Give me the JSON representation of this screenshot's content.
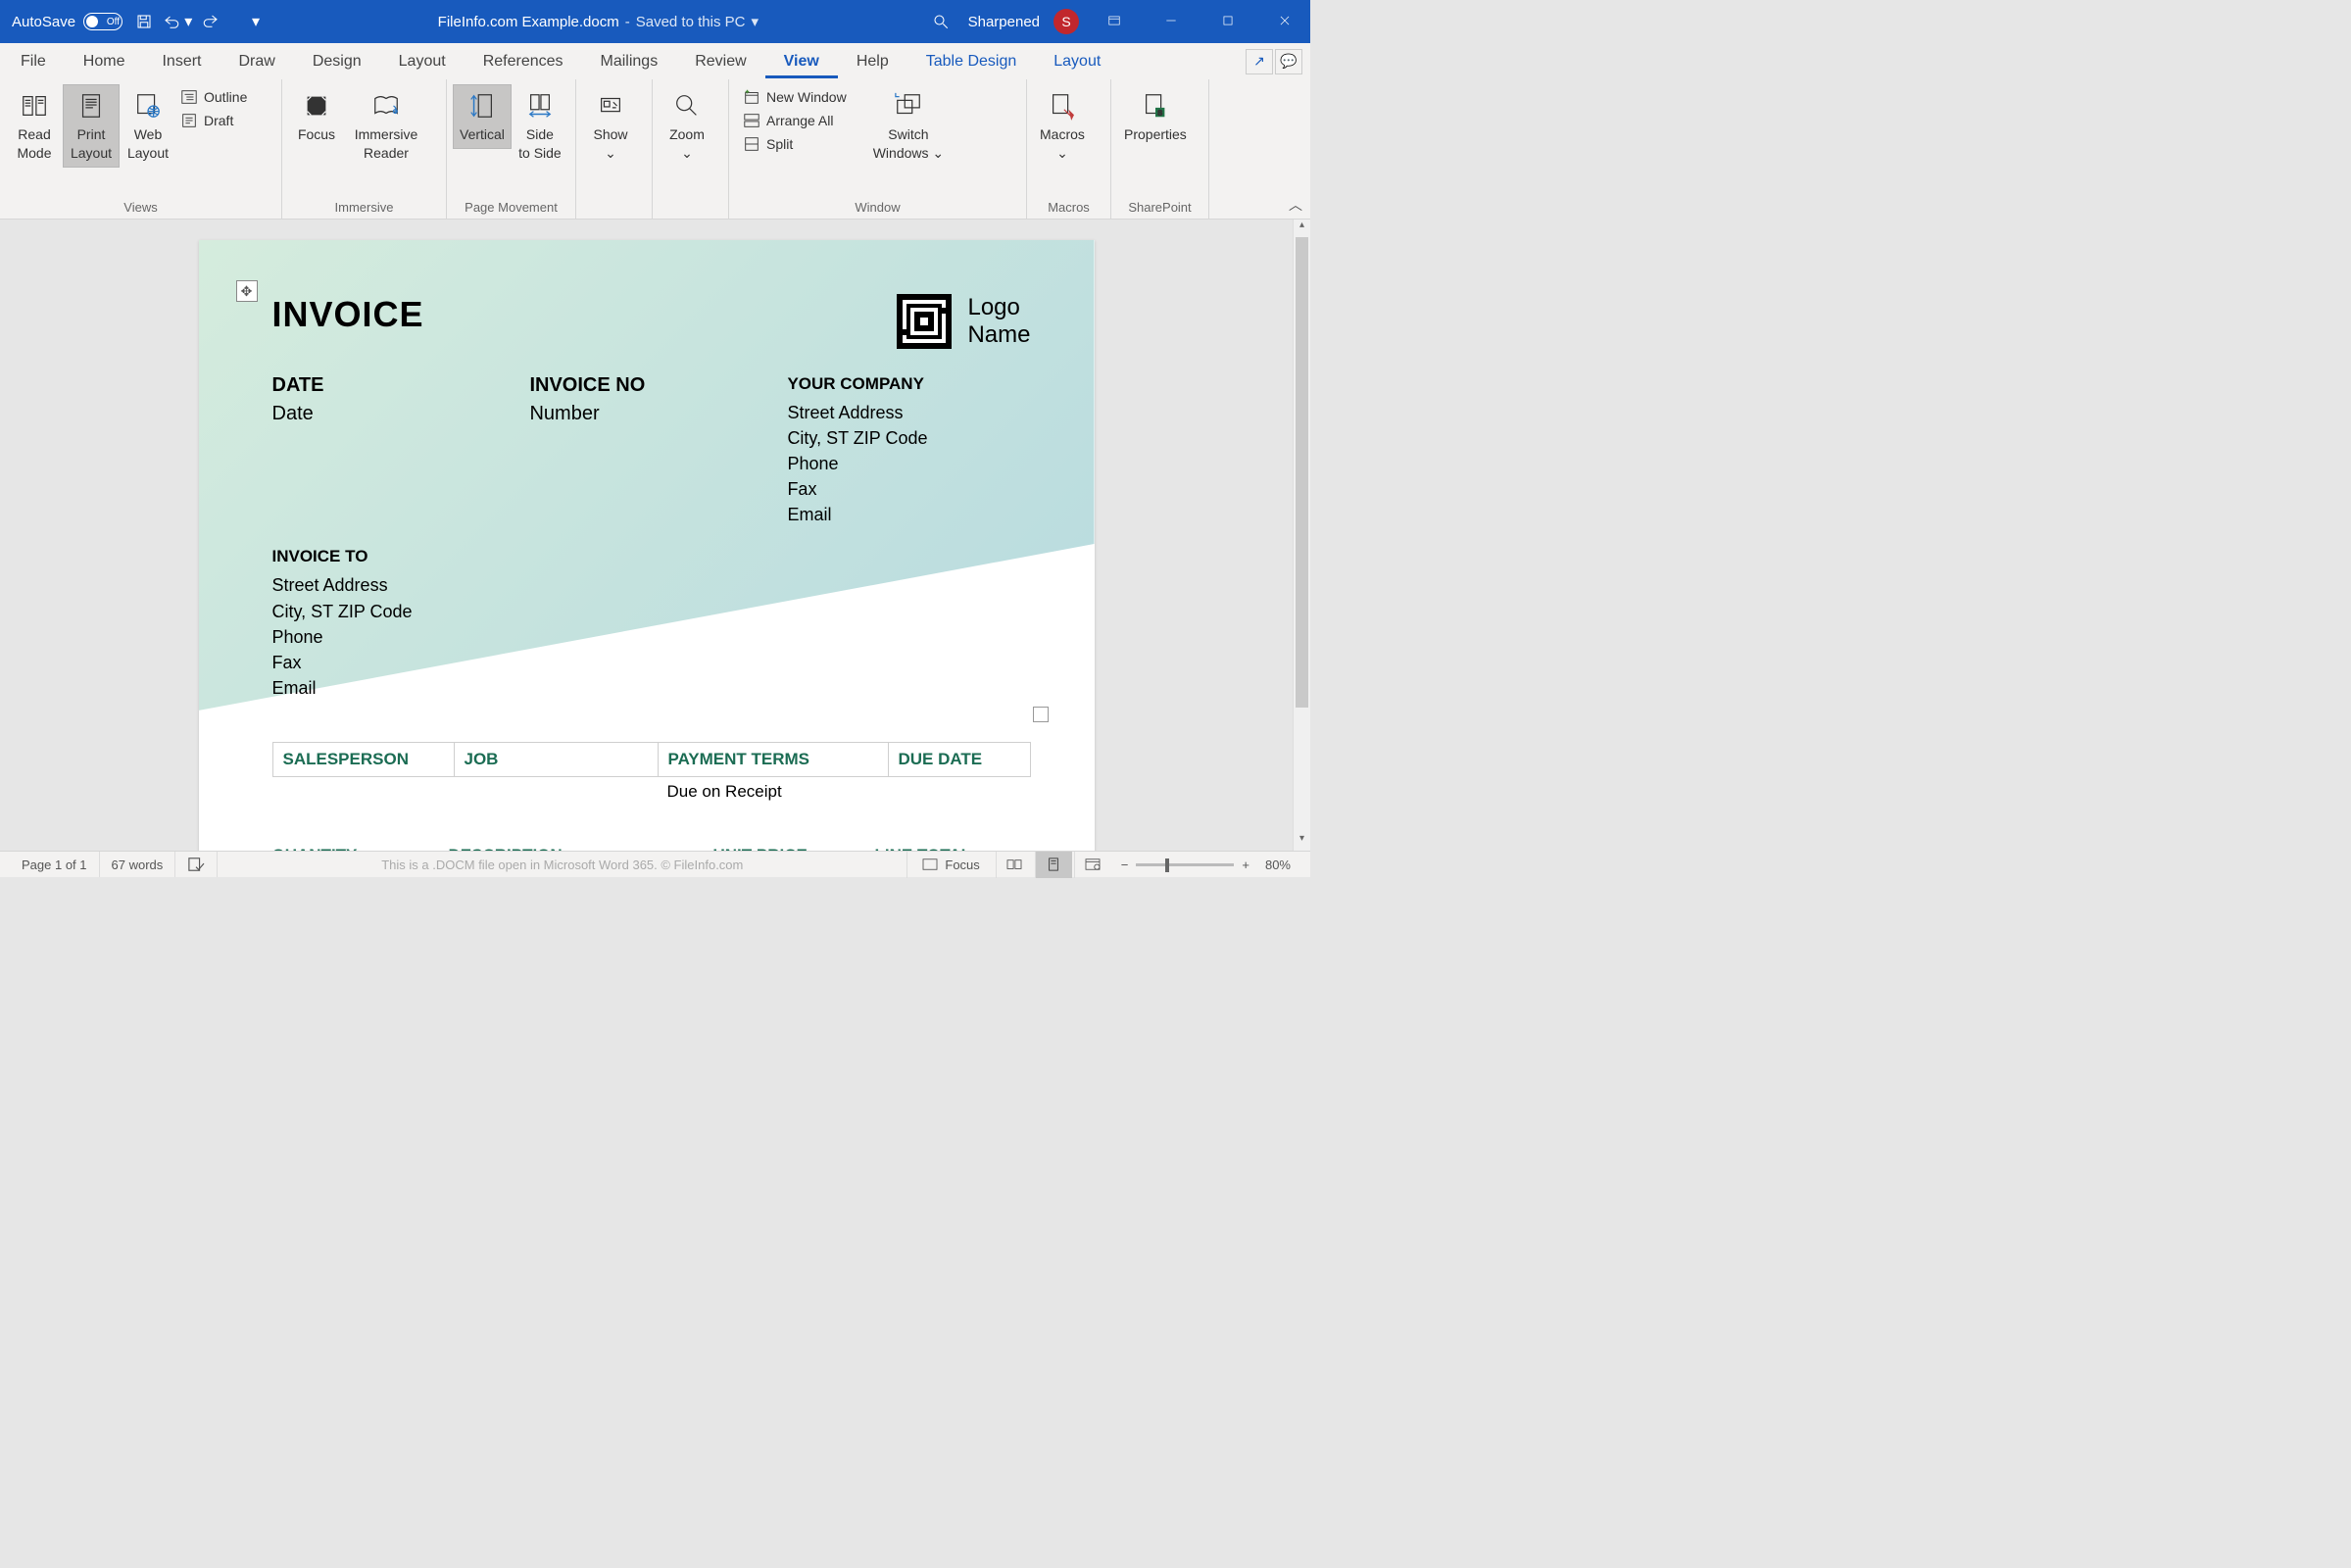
{
  "title_bar": {
    "autosave": "AutoSave",
    "toggle": "Off",
    "doc_name": "FileInfo.com Example.docm",
    "status": "Saved to this PC",
    "user": "Sharpened",
    "avatar": "S"
  },
  "tabs": [
    "File",
    "Home",
    "Insert",
    "Draw",
    "Design",
    "Layout",
    "References",
    "Mailings",
    "Review",
    "View",
    "Help",
    "Table Design",
    "Layout"
  ],
  "active_tab": "View",
  "ribbon": {
    "views": {
      "label": "Views",
      "read_mode": "Read Mode",
      "print_layout": "Print Layout",
      "web_layout": "Web Layout",
      "outline": "Outline",
      "draft": "Draft"
    },
    "immersive": {
      "label": "Immersive",
      "focus": "Focus",
      "reader": "Immersive Reader"
    },
    "page_movement": {
      "label": "Page Movement",
      "vertical": "Vertical",
      "side": "Side to Side"
    },
    "show": {
      "label": "Show"
    },
    "zoom": {
      "label": "Zoom"
    },
    "window": {
      "label": "Window",
      "new_window": "New Window",
      "arrange_all": "Arrange All",
      "split": "Split",
      "switch": "Switch Windows"
    },
    "macros": {
      "label": "Macros",
      "btn": "Macros"
    },
    "sharepoint": {
      "label": "SharePoint",
      "btn": "Properties"
    }
  },
  "document": {
    "title": "INVOICE",
    "logo_name1": "Logo",
    "logo_name2": "Name",
    "date_label": "DATE",
    "date_value": "Date",
    "invoice_no_label": "INVOICE NO",
    "invoice_no_value": "Number",
    "your_company_label": "YOUR COMPANY",
    "invoice_to_label": "INVOICE TO",
    "info": {
      "street": "Street Address",
      "city": "City, ST ZIP Code",
      "phone": "Phone",
      "fax": "Fax",
      "email": "Email"
    },
    "table1": {
      "salesperson": "SALESPERSON",
      "job": "JOB",
      "payment_terms": "PAYMENT TERMS",
      "due_date": "DUE DATE",
      "row_payment": "Due on Receipt"
    },
    "table2": {
      "quantity": "QUANTITY",
      "description": "DESCRIPTION",
      "unit_price": "UNIT PRICE",
      "line_total": "LINE TOTAL"
    }
  },
  "status_bar": {
    "page": "Page 1 of 1",
    "words": "67 words",
    "footer": "This is a .DOCM file open in Microsoft Word 365. © FileInfo.com",
    "focus": "Focus",
    "zoom": "80%"
  }
}
